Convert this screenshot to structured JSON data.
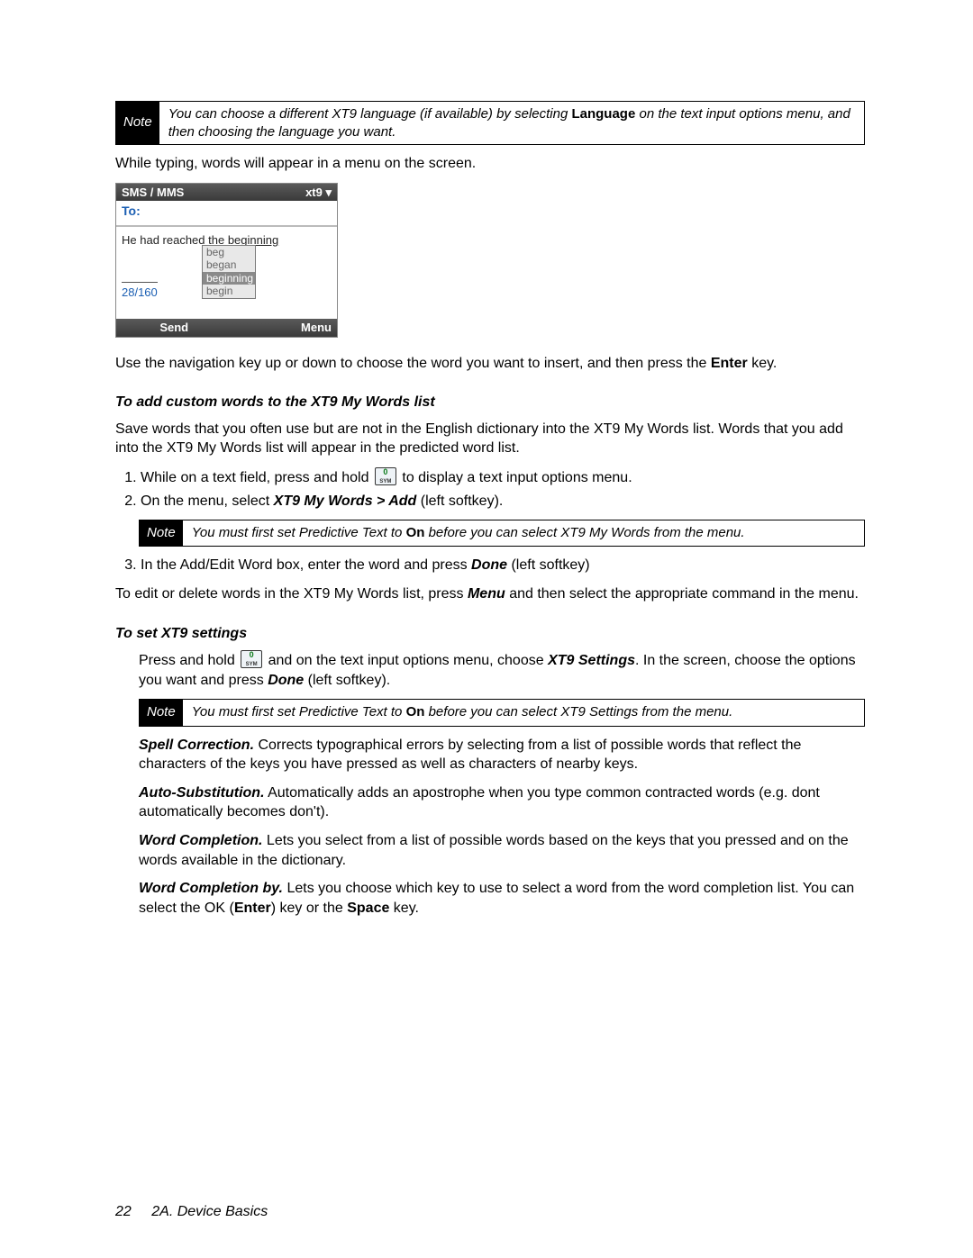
{
  "notes": {
    "note1": {
      "tag": "Note",
      "pre": "You can choose a different XT9 language (if available) by selecting ",
      "bold": "Language",
      "post": " on the text input options menu, and then choosing the language you want."
    },
    "note2": {
      "tag": "Note",
      "pre": "You must first set Predictive Text to ",
      "bold": "On",
      "post": " before you can select XT9 My Words from the menu."
    },
    "note3": {
      "tag": "Note",
      "pre": "You must first set Predictive Text to ",
      "bold": "On",
      "post": " before you can select XT9 Settings from the menu."
    }
  },
  "body": {
    "p1": "While typing, words will appear in a menu on the screen.",
    "p2_pre": "Use the navigation key up or down to choose the word you want to insert, and then press the ",
    "p2_bold": "Enter",
    "p2_post": " key.",
    "sub1": "To add custom words to the XT9 My Words list",
    "p3": "Save words that you often use but are not in the English dictionary into the XT9 My Words list. Words that you add into the XT9 My Words list will appear in the predicted word list.",
    "step1_pre": "While on a text field, press and hold ",
    "step1_post": " to display a text input options menu.",
    "step2_pre": "On the menu, select ",
    "step2_bold": "XT9 My Words > Add",
    "step2_post": " (left softkey).",
    "step3_pre": "In the Add/Edit Word box, enter the word and press ",
    "step3_bold": "Done",
    "step3_post": " (left softkey)",
    "p4_pre": "To edit or delete words in the XT9 My Words list, press ",
    "p4_bold": "Menu",
    "p4_post": " and then select the appropriate command in the menu.",
    "sub2": "To set XT9 settings",
    "p5_pre": "Press and hold ",
    "p5_mid": " and on the text input options menu, choose ",
    "p5_bold": "XT9 Settings",
    "p5_tail": ". In the screen, choose the options you want and press ",
    "p5_bold2": "Done",
    "p5_post": " (left softkey).",
    "opt1_head": "Spell Correction.",
    "opt1_body": " Corrects typographical errors by selecting from a list of possible words that reflect the characters of the keys you have pressed as well as characters of nearby keys.",
    "opt2_head": "Auto-Substitution.",
    "opt2_body": " Automatically adds an apostrophe when you type common contracted words (e.g. dont automatically becomes don't).",
    "opt3_head": "Word Completion.",
    "opt3_body": " Lets you select from a list of possible words based on the keys that you pressed and on the words available in the dictionary.",
    "opt4_head": "Word Completion by.",
    "opt4_body_pre": " Lets you choose which key to use to select a word from the word completion list. You can select the OK (",
    "opt4_enter": "Enter",
    "opt4_mid": ") key or the ",
    "opt4_space": "Space",
    "opt4_post": " key."
  },
  "phone": {
    "title_left": "SMS / MMS",
    "title_right": "xt9 ▾",
    "to_label": "To:",
    "typed_pre": "He had reached the ",
    "typed_word": "beginning",
    "counter": "28/160",
    "sug1": "beg",
    "sug2": "began",
    "sug3": "beginning",
    "sug4": "begin",
    "soft_left": "Send",
    "soft_right": "Menu"
  },
  "footer": {
    "page_no": "22",
    "section": "2A. Device Basics"
  }
}
